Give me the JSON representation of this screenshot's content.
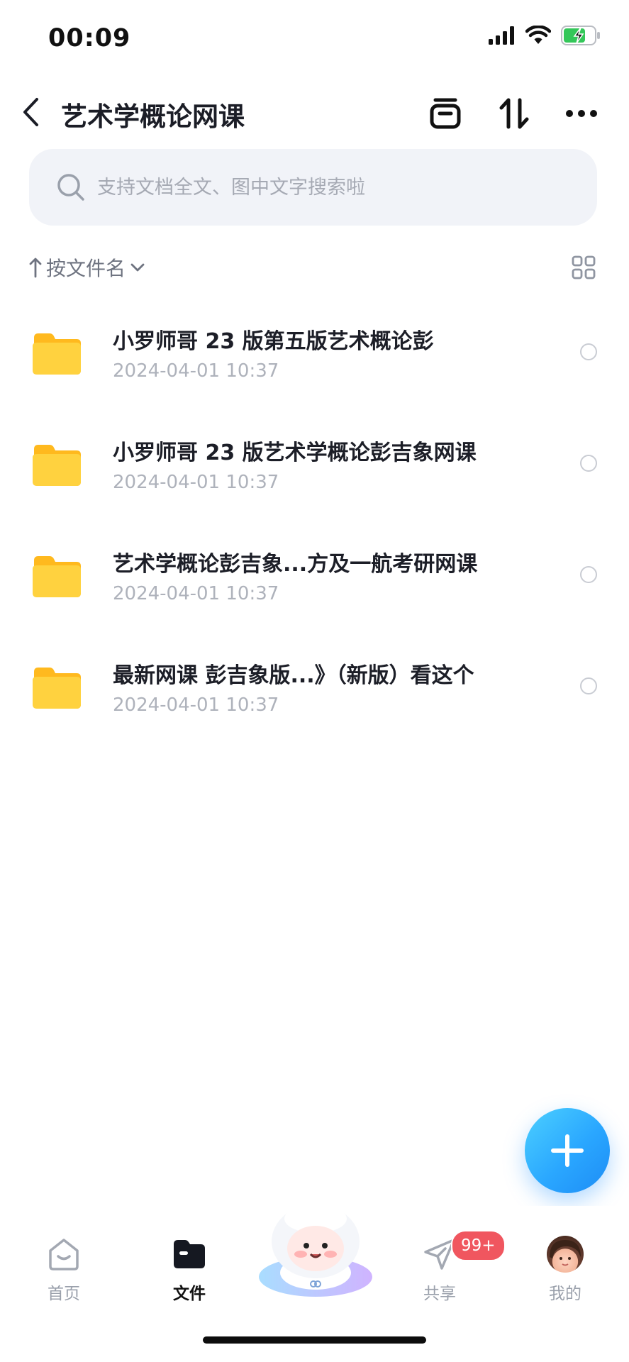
{
  "status_bar": {
    "time": "00:09"
  },
  "header": {
    "title": "艺术学概论网课"
  },
  "search": {
    "placeholder": "支持文档全文、图中文字搜索啦"
  },
  "sort": {
    "label": "按文件名"
  },
  "files": [
    {
      "name": "小罗师哥 23 版第五版艺术概论彭",
      "date": "2024-04-01 10:37"
    },
    {
      "name": "小罗师哥 23 版艺术学概论彭吉象网课",
      "date": "2024-04-01 10:37"
    },
    {
      "name": "艺术学概论彭吉象...方及一航考研网课",
      "date": "2024-04-01 10:37"
    },
    {
      "name": "最新网课 彭吉象版...》（新版）看这个",
      "date": "2024-04-01 10:37"
    }
  ],
  "bottom_nav": {
    "home": "首页",
    "files": "文件",
    "share": "共享",
    "share_badge": "99+",
    "me": "我的"
  },
  "colors": {
    "accent": "#2aa7ff",
    "folder": "#ffc83d",
    "badge": "#f0565f"
  }
}
